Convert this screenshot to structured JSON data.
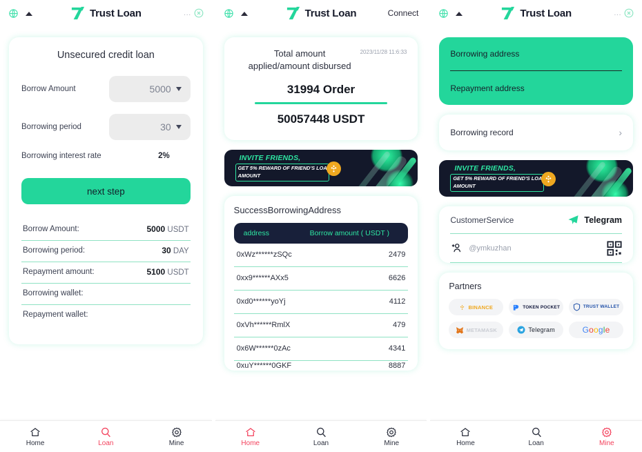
{
  "brand": {
    "name": "Trust Loan",
    "accent": "#23d69b",
    "dark": "#18203a",
    "danger": "#f3415c"
  },
  "header": {
    "globe_icon": "globe-icon",
    "dropdown_icon": "triangle-up-icon",
    "logo_icon": "trust-loan-logo-icon",
    "dots": "...",
    "close_icon": "close-circle-icon",
    "connect_label": "Connect"
  },
  "panel1": {
    "form": {
      "title": "Unsecured credit loan",
      "borrow_amount_label": "Borrow Amount",
      "borrow_amount_value": "5000",
      "borrowing_period_label": "Borrowing period",
      "borrowing_period_value": "30",
      "interest_rate_label": "Borrowing interest rate",
      "interest_rate_value": "2%",
      "next_button": "next step"
    },
    "summary": [
      {
        "key": "Borrow Amount:",
        "num": "5000",
        "unit": "USDT"
      },
      {
        "key": "Borrowing period:",
        "num": "30",
        "unit": "DAY"
      },
      {
        "key": "Repayment amount:",
        "num": "5100",
        "unit": "USDT"
      },
      {
        "key": "Borrowing wallet:",
        "num": "",
        "unit": ""
      },
      {
        "key": "Repayment wallet:",
        "num": "",
        "unit": ""
      }
    ]
  },
  "panel2": {
    "total": {
      "label": "Total amount applied/amount disbursed",
      "date": "2023/11/28\n11:6:33",
      "orders": "31994 Order",
      "usdt": "50057448 USDT"
    },
    "banner": {
      "line1": "INVITE FRIENDS,",
      "line2": "GET 5% REWARD OF FRIEND'S LOAN AMOUNT",
      "coin_icon": "binance-coin-icon"
    },
    "address_table": {
      "title": "SuccessBorrowingAddress",
      "col_address": "address",
      "col_amount": "Borrow amount ( USDT )",
      "rows": [
        {
          "address": "0xWz******zSQc",
          "amount": "2479"
        },
        {
          "address": "0xx9******AXx5",
          "amount": "6626"
        },
        {
          "address": "0xd0******yoYj",
          "amount": "4112"
        },
        {
          "address": "0xVh******RmlX",
          "amount": "479"
        },
        {
          "address": "0x6W******0zAc",
          "amount": "4341"
        },
        {
          "address": "0xuY******0GKF",
          "amount": "8887"
        }
      ]
    }
  },
  "panel3": {
    "addresses": {
      "borrowing": "Borrowing address",
      "repayment": "Repayment address"
    },
    "record": {
      "label": "Borrowing record",
      "chevron_icon": "chevron-right-icon"
    },
    "banner": {
      "line1": "INVITE FRIENDS,",
      "line2": "GET 5% REWARD OF FRIEND'S LOAN AMOUNT",
      "coin_icon": "binance-coin-icon"
    },
    "customer_service": {
      "label": "CustomerService",
      "channel": "Telegram",
      "plane_icon": "telegram-plane-icon",
      "handle": "@ymkuzhan",
      "add_user_icon": "add-user-icon",
      "qr_icon": "qr-code-icon"
    },
    "partners": {
      "title": "Partners",
      "items": [
        {
          "name": "BINANCE",
          "icon": "binance-icon"
        },
        {
          "name": "TOKEN POCKET",
          "icon": "token-pocket-icon"
        },
        {
          "name": "TRUST WALLET",
          "icon": "trust-wallet-icon"
        },
        {
          "name": "METAMASK",
          "icon": "metamask-icon"
        },
        {
          "name": "Telegram",
          "icon": "telegram-icon"
        },
        {
          "name": "Google",
          "icon": "google-icon"
        }
      ]
    }
  },
  "nav": {
    "home": "Home",
    "loan": "Loan",
    "mine": "Mine",
    "home_icon": "home-icon",
    "loan_icon": "search-icon",
    "mine_icon": "gear-icon",
    "active": {
      "panel1": "Loan",
      "panel2": "Home",
      "panel3": "Mine"
    }
  }
}
